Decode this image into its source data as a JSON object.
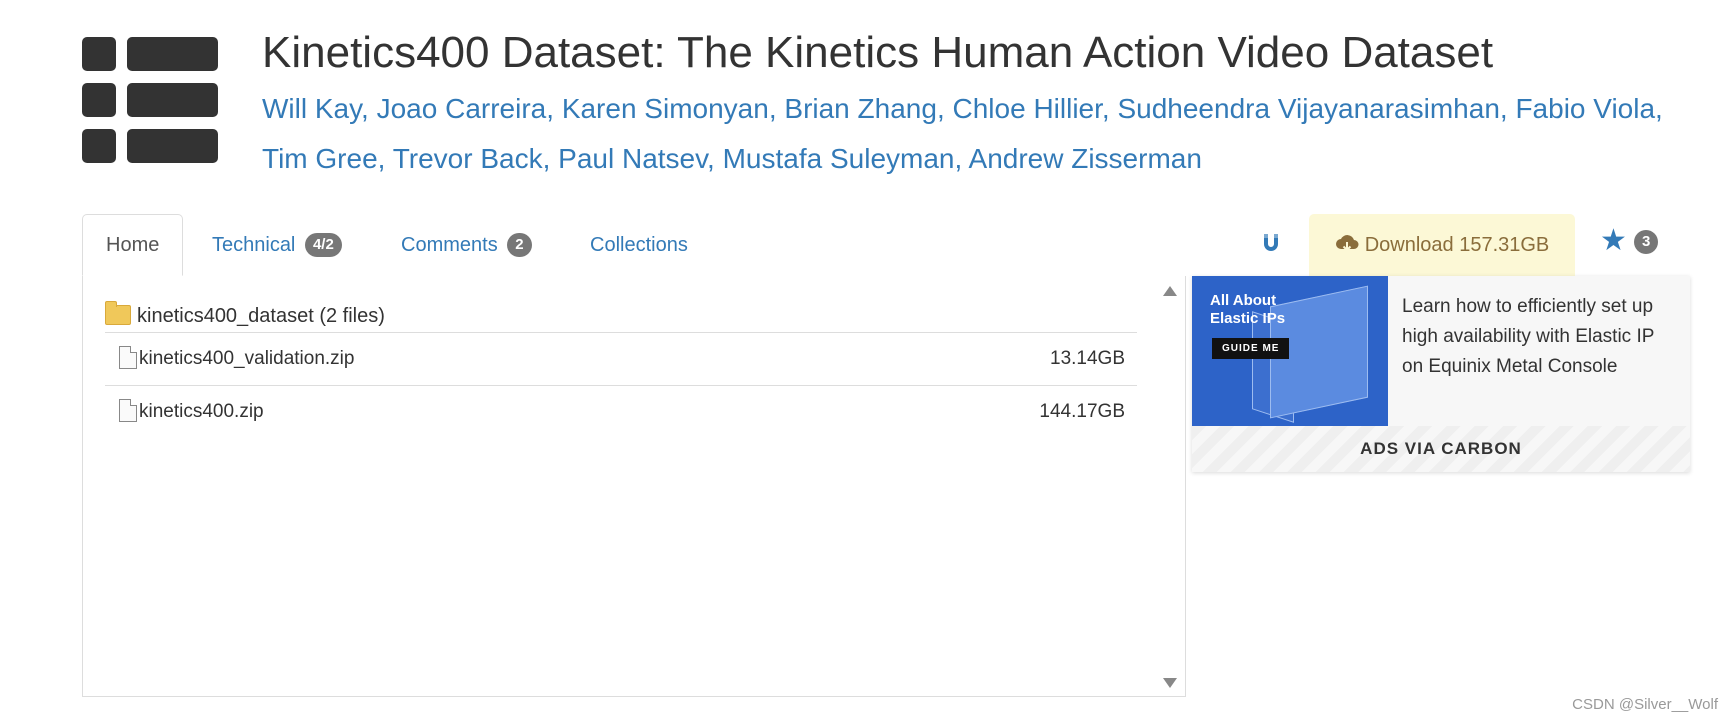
{
  "page": {
    "title": "Kinetics400 Dataset: The Kinetics Human Action Video Dataset",
    "authors": [
      "Will Kay",
      "Joao Carreira",
      "Karen Simonyan",
      "Brian Zhang",
      "Chloe Hillier",
      "Sudheendra Vijayanarasimhan",
      "Fabio Viola",
      "Tim Gree",
      "Trevor Back",
      "Paul Natsev",
      "Mustafa Suleyman",
      "Andrew Zisserman"
    ]
  },
  "tabs": [
    {
      "label": "Home",
      "badge": null,
      "active": true
    },
    {
      "label": "Technical",
      "badge": "4/2",
      "active": false
    },
    {
      "label": "Comments",
      "badge": "2",
      "active": false
    },
    {
      "label": "Collections",
      "badge": null,
      "active": false
    }
  ],
  "actions": {
    "magnet_icon": "magnet-icon",
    "download_label": "Download 157.31GB",
    "star_count": "3"
  },
  "files": {
    "folder_label": "kinetics400_dataset (2 files)",
    "items": [
      {
        "name": "kinetics400_validation.zip",
        "size": "13.14GB"
      },
      {
        "name": "kinetics400.zip",
        "size": "144.17GB"
      }
    ]
  },
  "ad": {
    "image_headline": "All About Elastic IPs",
    "image_button": "GUIDE ME",
    "text": "Learn how to efficiently set up high availability with Elastic IP on Equinix Metal Console",
    "footer": "ADS VIA CARBON"
  },
  "watermark": "CSDN @Silver__Wolf",
  "colors": {
    "link": "#337ab7",
    "download_bg": "#fcf8d6",
    "download_text": "#8a6d3b",
    "badge": "#777777"
  }
}
